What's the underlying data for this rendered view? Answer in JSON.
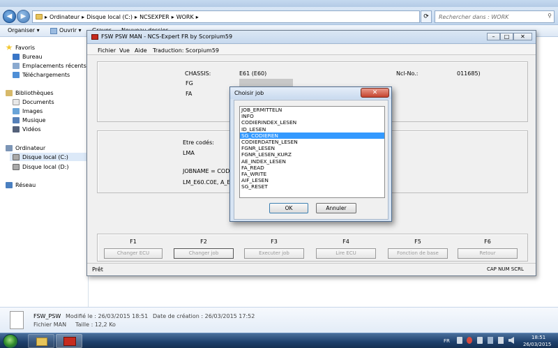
{
  "explorer": {
    "breadcrumb": [
      "Ordinateur",
      "Disque local (C:)",
      "NCSEXPER",
      "WORK"
    ],
    "search_placeholder": "Rechercher dans : WORK",
    "toolbar": {
      "organize": "Organiser ▾",
      "open": "Ouvrir ▾",
      "burn": "Graver",
      "new_folder": "Nouveau dossier"
    },
    "nav": {
      "favorites": "Favoris",
      "office": "Bureau",
      "recent": "Emplacements récents",
      "downloads": "Téléchargements",
      "libraries": "Bibliothèques",
      "documents": "Documents",
      "images": "Images",
      "music": "Musique",
      "videos": "Vidéos",
      "computer": "Ordinateur",
      "disk_c": "Disque local (C:)",
      "disk_d": "Disque local (D:)",
      "network": "Réseau"
    },
    "details": {
      "name": "FSW_PSW",
      "type": "Fichier MAN",
      "modified": "Modifié le : 26/03/2015 18:51",
      "size": "Taille : 12,2 Ko",
      "created": "Date de création : 26/03/2015 17:52"
    }
  },
  "taskbar": {
    "lang": "FR",
    "time": "18:51",
    "date": "26/03/2015"
  },
  "app": {
    "title": "FSW PSW MAN - NCS-Expert FR by Scorpium59",
    "menu": {
      "file": "Fichier",
      "view": "Vue",
      "help": "Aide",
      "translation": "Traduction: Scorpium59"
    },
    "info": {
      "chassis_label": "CHASSIS:",
      "chassis_value": "E61 (E60)",
      "fg_label": "FG",
      "fa_label": "FA",
      "ncl_label": "Ncl-No.:",
      "ncl_value": "011685)"
    },
    "codes": {
      "label": "Etre codés:",
      "lma": "LMA",
      "jobname": "JOBNAME = CODIERE",
      "lm_path": "LM_E60.C0E, A_E60LM"
    },
    "fkeys": [
      {
        "key": "F1",
        "label": "Changer ECU"
      },
      {
        "key": "F2",
        "label": "Changer job"
      },
      {
        "key": "F3",
        "label": "Executer job"
      },
      {
        "key": "F4",
        "label": "Lire ECU"
      },
      {
        "key": "F5",
        "label": "Fonction de base"
      },
      {
        "key": "F6",
        "label": "Retour"
      }
    ],
    "status": {
      "ready": "Prêt",
      "indicators": "CAP NUM SCRL"
    }
  },
  "dialog": {
    "title": "Choisir job",
    "jobs": [
      "JOB_ERMITTELN",
      "INFO",
      "CODIERINDEX_LESEN",
      "ID_LESEN",
      "SG_CODIEREN",
      "CODIERDATEN_LESEN",
      "FGNR_LESEN",
      "FGNR_LESEN_KURZ",
      "AE_INDEX_LESEN",
      "FA_READ",
      "FA_WRITE",
      "AIF_LESEN",
      "SG_RESET"
    ],
    "selected_index": 4,
    "ok": "OK",
    "cancel": "Annuler"
  }
}
